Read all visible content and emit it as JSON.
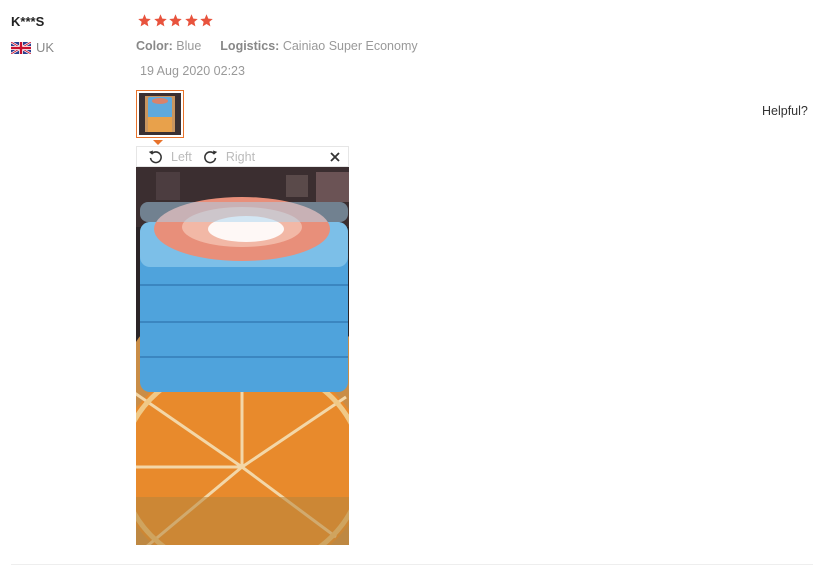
{
  "review": {
    "user_name": "K***S",
    "country": "UK",
    "rating": 5,
    "star_color": "#e8533d",
    "color_label": "Color:",
    "color_value": "Blue",
    "logistics_label": "Logistics:",
    "logistics_value": "Cainiao Super Economy",
    "date": "19 Aug 2020 02:23",
    "helpful_label": "Helpful?"
  },
  "viewer": {
    "rotate_left_label": "Left",
    "rotate_right_label": "Right",
    "icons": [
      "rotate-left-icon",
      "rotate-right-icon",
      "close-icon"
    ]
  },
  "colors": {
    "accent": "#e8732b",
    "muted_text": "#999999"
  }
}
